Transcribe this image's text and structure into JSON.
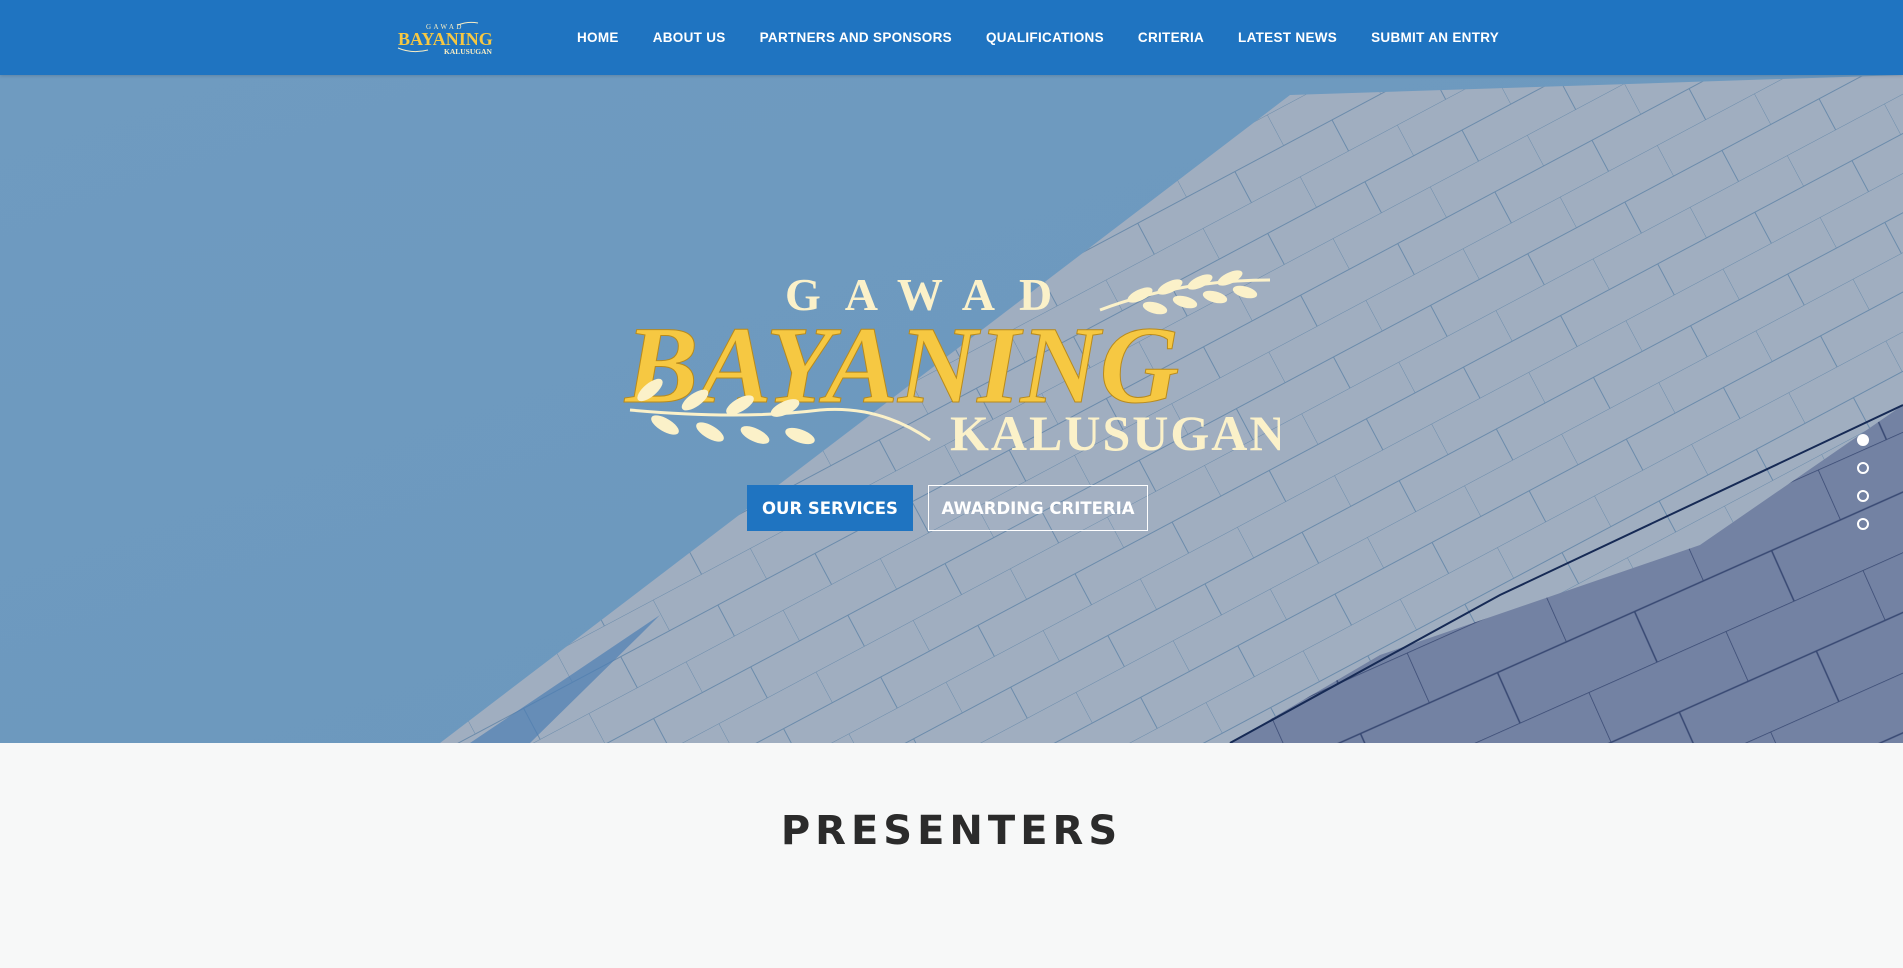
{
  "brand": {
    "logo_small": {
      "line1": "GAWAD",
      "line2": "BAYANING",
      "line3": "KALUSUGAN"
    },
    "logo_large": {
      "line1": "GAWAD",
      "line2": "BAYANING",
      "line3": "KALUSUGAN"
    },
    "colors": {
      "nav_bg": "#1f74c1",
      "gold": "#f6c842",
      "cream": "#f8edc4"
    }
  },
  "nav": {
    "items": [
      {
        "label": "HOME"
      },
      {
        "label": "ABOUT US"
      },
      {
        "label": "PARTNERS AND SPONSORS"
      },
      {
        "label": "QUALIFICATIONS"
      },
      {
        "label": "CRITERIA"
      },
      {
        "label": "LATEST NEWS"
      },
      {
        "label": "SUBMIT AN ENTRY"
      }
    ]
  },
  "hero": {
    "primary_button": "OUR SERVICES",
    "secondary_button": "AWARDING CRITERIA",
    "slides_count": 4,
    "active_slide": 1
  },
  "presenters": {
    "title": "PRESENTERS"
  }
}
